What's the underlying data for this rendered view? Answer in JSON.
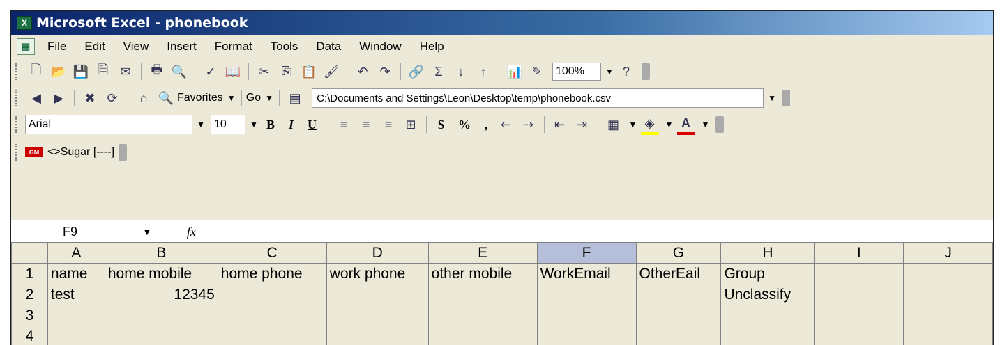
{
  "window": {
    "title": "Microsoft Excel - phonebook",
    "app_icon": "X"
  },
  "menu": {
    "items": [
      "File",
      "Edit",
      "View",
      "Insert",
      "Format",
      "Tools",
      "Data",
      "Window",
      "Help"
    ]
  },
  "standard_toolbar": {
    "zoom": "100%"
  },
  "web_toolbar": {
    "favorites": "Favorites",
    "go": "Go",
    "address": "C:\\Documents and Settings\\Leon\\Desktop\\temp\\phonebook.csv"
  },
  "format_toolbar": {
    "font": "Arial",
    "size": "10",
    "bold": "B",
    "italic": "I",
    "underline": "U",
    "currency": "$",
    "percent": "%",
    "comma": ",",
    "font_color_letter": "A"
  },
  "sugar_toolbar": {
    "badge": "GM",
    "label": "<>Sugar [----]"
  },
  "formula_bar": {
    "name_box": "F9",
    "fx": "fx"
  },
  "sheet": {
    "columns": [
      "A",
      "B",
      "C",
      "D",
      "E",
      "F",
      "G",
      "H",
      "I",
      "J"
    ],
    "rows": [
      {
        "num": "1",
        "cells": [
          "name",
          "home mobile",
          "home phone",
          "work phone",
          "other mobile",
          "WorkEmail",
          "OtherEail",
          "Group",
          "",
          ""
        ]
      },
      {
        "num": "2",
        "cells": [
          "test",
          "12345",
          "",
          "",
          "",
          "",
          "",
          "Unclassify",
          "",
          ""
        ]
      },
      {
        "num": "3",
        "cells": [
          "",
          "",
          "",
          "",
          "",
          "",
          "",
          "",
          "",
          ""
        ]
      },
      {
        "num": "4",
        "cells": [
          "",
          "",
          "",
          "",
          "",
          "",
          "",
          "",
          "",
          ""
        ]
      }
    ]
  }
}
